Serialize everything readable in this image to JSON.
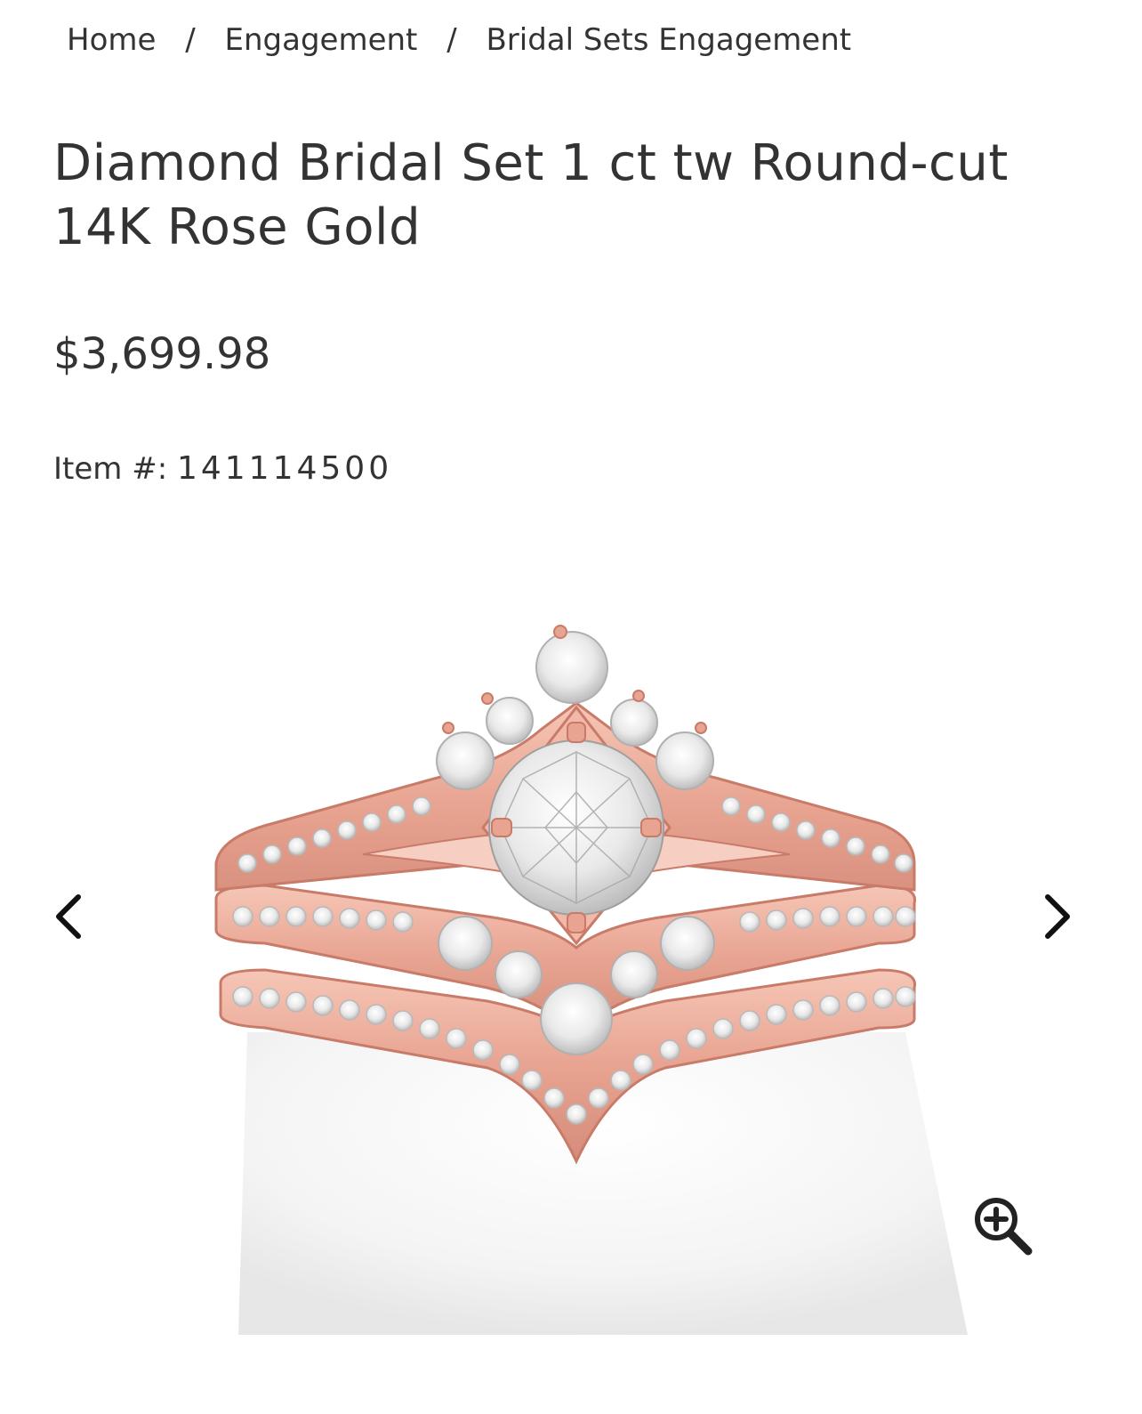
{
  "breadcrumb": {
    "items": [
      "Home",
      "Engagement",
      "Bridal Sets Engagement"
    ],
    "separator": "/"
  },
  "product": {
    "title": "Diamond Bridal Set 1 ct tw Round-cut 14K Rose Gold",
    "price": "$3,699.98",
    "item_label": "Item #:",
    "item_number": "141114500"
  },
  "gallery": {
    "prev_icon": "chevron-left-icon",
    "next_icon": "chevron-right-icon",
    "zoom_icon": "zoom-in-icon"
  },
  "colors": {
    "text": "#333333",
    "rose_gold": "#e8a391",
    "rose_gold_dark": "#c97b69",
    "diamond": "#f4f4f4"
  }
}
